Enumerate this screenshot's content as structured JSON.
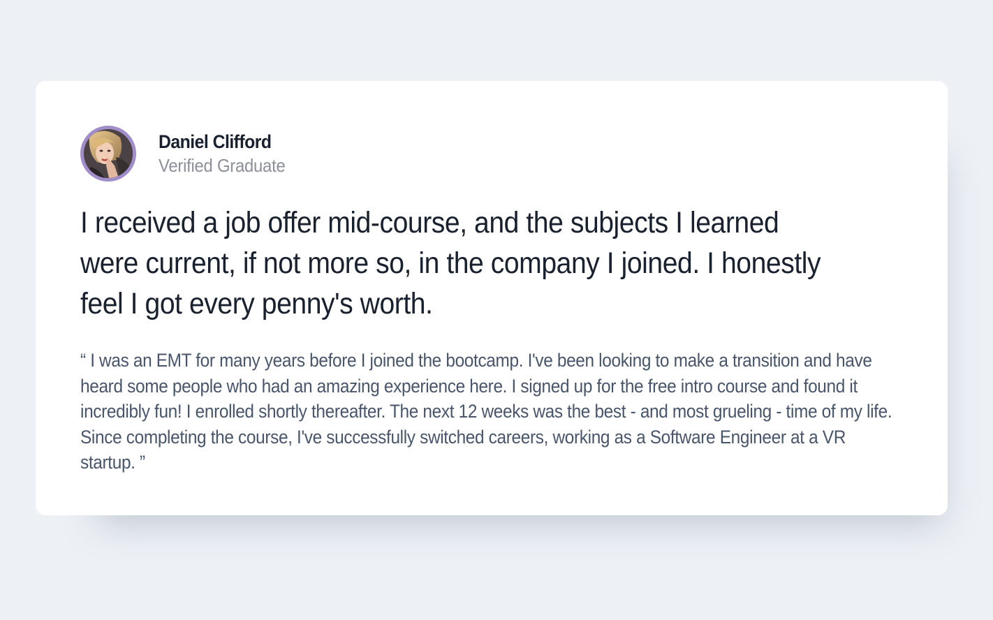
{
  "testimonial": {
    "author": {
      "name": "Daniel Clifford",
      "role": "Verified Graduate",
      "avatar_icon": "avatar-photo"
    },
    "headline": "I received a job offer mid-course, and the subjects I learned were current, if not more so, in the company I joined. I honestly feel I got every penny's worth.",
    "quote": "“ I was an EMT for many years before I joined the bootcamp. I've been looking to make a transition and have heard some people who had an amazing experience here. I signed up for the free intro course and found it incredibly fun! I enrolled shortly thereafter. The next 12 weeks was the best - and most grueling - time of my life. Since completing the course, I've successfully switched careers, working as a Software Engineer at a VR startup. ”"
  },
  "colors": {
    "background": "#edf1f6",
    "card": "#ffffff",
    "avatar_border": "#a28dcb",
    "name_text": "#19212e",
    "role_text": "#8b9099",
    "quote_text": "#48556a"
  }
}
